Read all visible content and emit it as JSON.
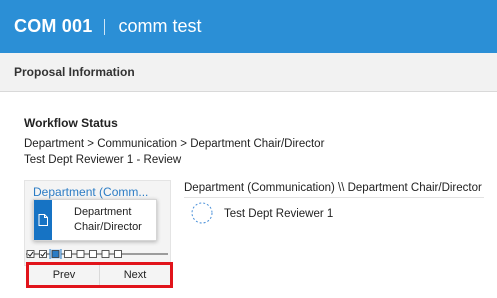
{
  "header": {
    "course_code": "COM 001",
    "course_title": "comm test",
    "background_color": "#2b8fd6"
  },
  "section": {
    "title": "Proposal Information"
  },
  "workflow": {
    "heading": "Workflow Status",
    "path": "Department > Communication > Department Chair/Director",
    "current_step": "Test Dept Reviewer 1 - Review",
    "node_title": "Department (Comm...",
    "tooltip_label": "Department Chair/Director",
    "tooltip_icon": "document-icon",
    "steps": [
      {
        "state": "complete"
      },
      {
        "state": "complete"
      },
      {
        "state": "current"
      },
      {
        "state": "pending"
      },
      {
        "state": "pending"
      },
      {
        "state": "pending"
      },
      {
        "state": "pending"
      },
      {
        "state": "pending"
      }
    ],
    "prev_label": "Prev",
    "next_label": "Next",
    "highlight_color": "#e1141b"
  },
  "detail": {
    "path": "Department (Communication) \\\\ Department Chair/Director",
    "reviewer_name": "Test Dept Reviewer 1",
    "reviewer_icon": "pending-reviewer-icon"
  }
}
